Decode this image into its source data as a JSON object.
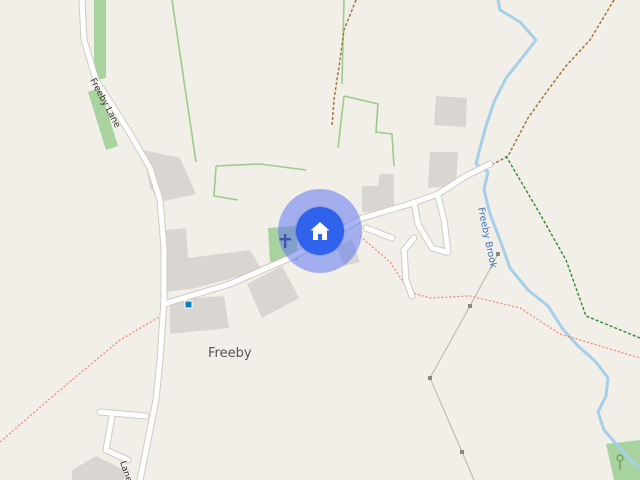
{
  "map": {
    "place_label": "Freeby",
    "roads": [
      {
        "id": "freeby-lane-north",
        "label": "Freeby Lane"
      },
      {
        "id": "freeby-lane-south",
        "label": "Lane"
      }
    ],
    "waterways": [
      {
        "id": "freeby-brook",
        "label": "Freeby Brook"
      }
    ],
    "marker": {
      "icon": "home-icon",
      "color": "#2f63ec",
      "halo_color": "#6078f0"
    },
    "poi": [
      {
        "id": "church",
        "icon": "church-cross-icon"
      },
      {
        "id": "bus-stop",
        "icon": "bus-stop-icon"
      },
      {
        "id": "park-marker",
        "icon": "park-pin-icon"
      }
    ],
    "colors": {
      "land": "#f2efe9",
      "road": "#ffffff",
      "road_casing": "#cfcac2",
      "building": "#d9d6d2",
      "water": "#a6cfe8",
      "park": "#a9d39e",
      "footpath": "#f08a7a",
      "track": "#a0773a",
      "boundary_green": "#2e8a2e"
    }
  }
}
